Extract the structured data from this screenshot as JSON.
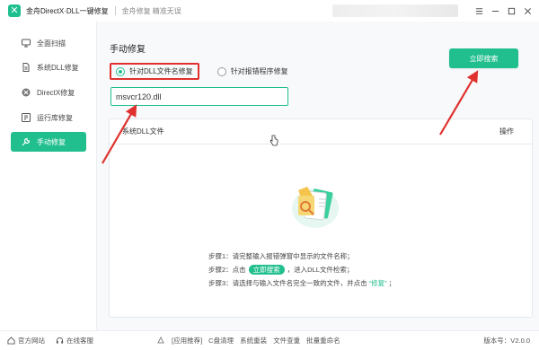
{
  "titlebar": {
    "app_title": "金舟DirectX·DLL一键修复",
    "subtitle": "金舟修复 精准无误"
  },
  "sidebar": {
    "items": [
      {
        "label": "全面扫描",
        "icon": "monitor-icon"
      },
      {
        "label": "系统DLL修复",
        "icon": "dll-file-icon"
      },
      {
        "label": "DirectX修复",
        "icon": "directx-icon"
      },
      {
        "label": "运行库修复",
        "icon": "library-icon"
      },
      {
        "label": "手动修复",
        "icon": "wrench-icon",
        "active": true
      }
    ]
  },
  "main": {
    "title": "手动修复",
    "radio_options": [
      {
        "label": "针对DLL文件名修复",
        "selected": true
      },
      {
        "label": "针对报错程序修复",
        "selected": false
      }
    ],
    "search_button": "立即搜索",
    "input_value": "msvcr120.dll",
    "table_headers": {
      "file": "系统DLL文件",
      "action": "操作"
    },
    "steps": {
      "step1": "步骤1：请完整输入报错弹窗中显示的文件名称；",
      "step2_prefix": "步骤2：点击",
      "step2_button": "立即搜索",
      "step2_suffix": "，进入DLL文件检索；",
      "step3_prefix": "步骤3：请选择与输入文件名完全一致的文件，并点击",
      "step3_highlight": "“修复”",
      "step3_suffix": "；"
    }
  },
  "statusbar": {
    "website": "官方网站",
    "support": "在线客服",
    "links": [
      "[应用推荐]",
      "C盘清理",
      "系统重装",
      "文件查重",
      "批量重命名"
    ],
    "version": "版本号：V2.0.0"
  },
  "colors": {
    "accent": "#22bf8e",
    "annotation": "#e0312e"
  }
}
